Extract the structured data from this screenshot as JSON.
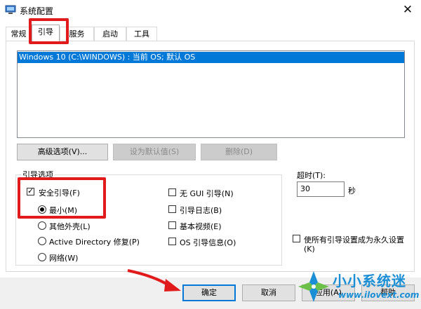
{
  "window": {
    "title": "系统配置",
    "close_symbol": "✕"
  },
  "tabs": [
    {
      "label": "常规",
      "active": false
    },
    {
      "label": "引导",
      "active": true
    },
    {
      "label": "服务",
      "active": false
    },
    {
      "label": "启动",
      "active": false
    },
    {
      "label": "工具",
      "active": false
    }
  ],
  "os_list": {
    "items": [
      "Windows 10 (C:\\WINDOWS) : 当前 OS; 默认 OS"
    ]
  },
  "actions": {
    "advanced": "高级选项(V)...",
    "set_default": "设为默认值(S)",
    "delete": "删除(D)"
  },
  "boot_options": {
    "group_label": "引导选项",
    "safe_boot": {
      "label": "安全引导(F)",
      "checked": true
    },
    "radios": [
      {
        "label": "最小(M)",
        "checked": true
      },
      {
        "label": "其他外壳(L)",
        "checked": false
      },
      {
        "label": "Active Directory 修复(P)",
        "checked": false
      },
      {
        "label": "网络(W)",
        "checked": false
      }
    ],
    "checks": [
      {
        "label": "无 GUI 引导(N)",
        "checked": false
      },
      {
        "label": "引导日志(B)",
        "checked": false
      },
      {
        "label": "基本视频(E)",
        "checked": false
      },
      {
        "label": "OS 引导信息(O)",
        "checked": false
      }
    ]
  },
  "timeout": {
    "label": "超时(T):",
    "value": "30",
    "unit": "秒"
  },
  "permanent": {
    "label_line1": "使所有引导设置成为永久设置",
    "label_line2": "(K)",
    "checked": false
  },
  "footer": {
    "ok": "确定",
    "cancel": "取消",
    "apply": "应用(A)",
    "help": "帮助"
  },
  "watermark": {
    "text": "小小系统迷",
    "url": "www.ilovext.com"
  },
  "colors": {
    "selection": "#0078d7",
    "highlight": "#e11b1b",
    "watermark": "#1b8fd6"
  }
}
